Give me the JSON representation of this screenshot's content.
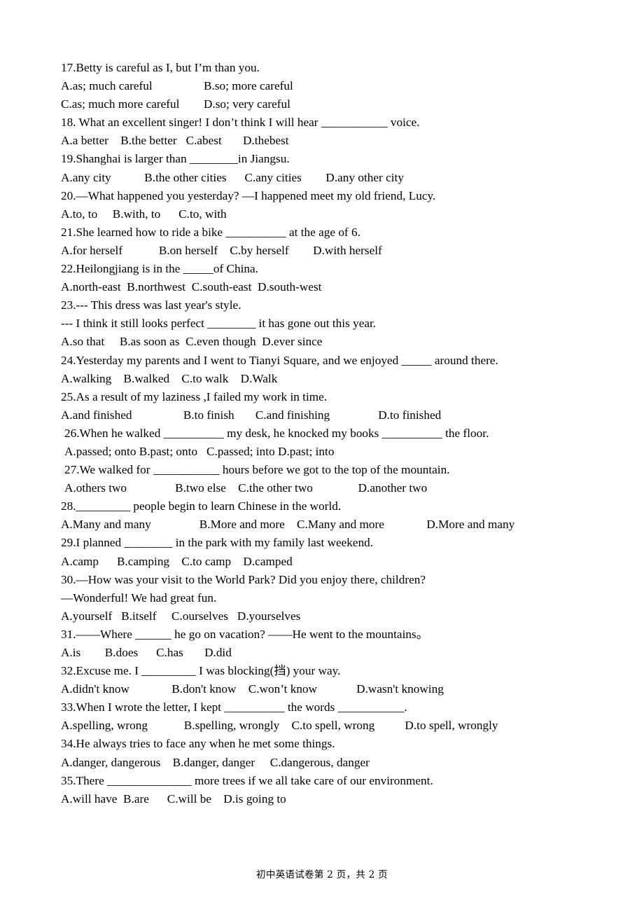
{
  "document": {
    "type": "exam-paper",
    "subject": "English",
    "page_label": "初中英语试卷第 2 页，共 2 页"
  },
  "questions": [
    {
      "id": "q17",
      "indent": false,
      "lines": [
        "17.Betty is careful as I, but I’m than you.",
        "A.as; much careful                 B.so; more careful",
        "C.as; much more careful        D.so; very careful"
      ]
    },
    {
      "id": "q18",
      "indent": false,
      "lines": [
        "18. What an excellent singer! I don’t think I will hear ___________ voice.",
        "A.a better    B.the better   C.abest       D.thebest"
      ]
    },
    {
      "id": "q19",
      "indent": false,
      "lines": [
        "19.Shanghai is larger than ________in Jiangsu.",
        "A.any city           B.the other cities      C.any cities        D.any other city"
      ]
    },
    {
      "id": "q20",
      "indent": false,
      "lines": [
        "20.—What happened you yesterday? —I happened meet my old friend, Lucy.",
        "A.to, to     B.with, to      C.to, with"
      ]
    },
    {
      "id": "q21",
      "indent": false,
      "lines": [
        "21.She learned how to ride a bike __________ at the age of 6.",
        "A.for herself            B.on herself    C.by herself        D.with herself"
      ]
    },
    {
      "id": "q22",
      "indent": false,
      "lines": [
        "22.Heilongjiang is in the _____of China.",
        "A.north-east  B.northwest  C.south-east  D.south-west"
      ]
    },
    {
      "id": "q23",
      "indent": false,
      "lines": [
        "23.--- This dress was last year's style.",
        "--- I think it still looks perfect ________ it has gone out this year.",
        "A.so that     B.as soon as  C.even though  D.ever since"
      ]
    },
    {
      "id": "q24",
      "indent": false,
      "lines": [
        "24.Yesterday my parents and I went to Tianyi Square, and we enjoyed _____ around there.",
        "A.walking    B.walked    C.to walk    D.Walk"
      ]
    },
    {
      "id": "q25",
      "indent": false,
      "lines": [
        "25.As a result of my laziness ,I failed my work in time.",
        "A.and finished                 B.to finish       C.and finishing                D.to finished"
      ]
    },
    {
      "id": "q26",
      "indent": true,
      "lines": [
        "26.When he walked __________ my desk, he knocked my books __________ the floor.",
        "A.passed; onto B.past; onto   C.passed; into D.past; into"
      ]
    },
    {
      "id": "q27",
      "indent": true,
      "lines": [
        "27.We walked for ___________ hours before we got to the top of the mountain.",
        "A.others two                B.two else    C.the other two               D.another two"
      ]
    },
    {
      "id": "q28",
      "indent": false,
      "lines": [
        "28._________ people begin to learn Chinese in the world.",
        "A.Many and many                B.More and more    C.Many and more              D.More and many"
      ]
    },
    {
      "id": "q29",
      "indent": false,
      "lines": [
        "29.I planned ________ in the park with my family last weekend.",
        "A.camp      B.camping    C.to camp    D.camped"
      ]
    },
    {
      "id": "q30",
      "indent": false,
      "lines": [
        "30.—How was your visit to the World Park? Did you enjoy there, children?",
        "—Wonderful! We had great fun.",
        "A.yourself   B.itself     C.ourselves   D.yourselves"
      ]
    },
    {
      "id": "q31",
      "indent": false,
      "lines": [
        "31.——Where ______ he go on vacation? ——He went to the mountains。",
        "A.is        B.does      C.has       D.did"
      ]
    },
    {
      "id": "q32",
      "indent": false,
      "lines": [
        "32.Excuse me. I _________ I was blocking(挡) your way.",
        "A.didn't know              B.don't know    C.won’t know             D.wasn't knowing"
      ]
    },
    {
      "id": "q33",
      "indent": false,
      "lines": [
        "33.When I wrote the letter, I kept __________ the words ___________.",
        "A.spelling, wrong            B.spelling, wrongly    C.to spell, wrong          D.to spell, wrongly"
      ]
    },
    {
      "id": "q34",
      "indent": false,
      "lines": [
        "34.He always tries to face any when he met some things.",
        "A.danger, dangerous    B.danger, danger     C.dangerous, danger"
      ]
    },
    {
      "id": "q35",
      "indent": false,
      "lines": [
        "35.There ______________ more trees if we all take care of our environment.",
        "A.will have  B.are      C.will be    D.is going to"
      ]
    }
  ]
}
